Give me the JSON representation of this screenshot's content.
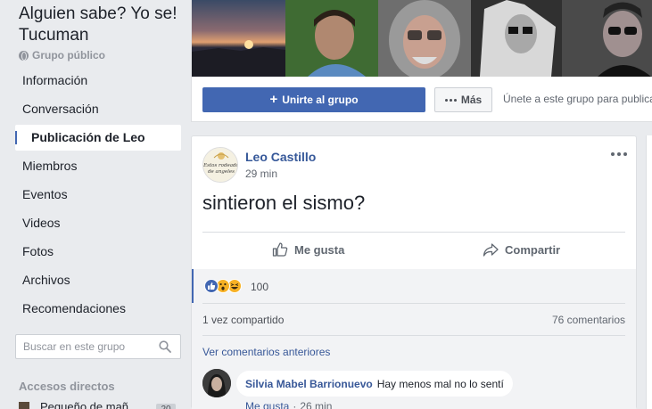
{
  "sidebar": {
    "group_title": "Alguien sabe? Yo se! Tucuman",
    "group_type": "Grupo público",
    "nav": [
      "Información",
      "Conversación",
      "Publicación de Leo",
      "Miembros",
      "Eventos",
      "Videos",
      "Fotos",
      "Archivos",
      "Recomendaciones"
    ],
    "active_index": 2,
    "search_placeholder": "Buscar en este grupo",
    "shortcuts_title": "Accesos directos",
    "shortcut_label": "Pequeño de mañ...",
    "shortcut_badge": "20"
  },
  "header": {
    "join_label": "Unirte al grupo",
    "more_label": "Más",
    "join_hint": "Únete a este grupo para publicar"
  },
  "post": {
    "author": "Leo Castillo",
    "time": "29 min",
    "text": "sintieron el sismo?",
    "logo_text": "Estos rodeado de angeles",
    "like_label": "Me gusta",
    "share_label": "Compartir",
    "reaction_count": "100",
    "shares": "1 vez compartido",
    "comments_count": "76 comentarios",
    "prev_comments": "Ver comentarios anteriores",
    "comment": {
      "name": "Silvia Mabel Barrionuevo",
      "text": "Hay menos mal no lo sentí",
      "like": "Me gusta",
      "sep": "·",
      "time": "26 min"
    }
  },
  "colors": {
    "accent": "#4267b2",
    "link": "#365899",
    "background": "#e9ebee"
  }
}
